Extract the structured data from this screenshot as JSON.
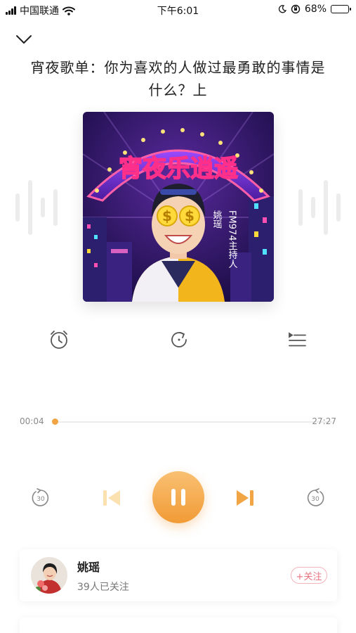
{
  "status_bar": {
    "carrier": "中国联通",
    "time": "下午6:01",
    "battery": "68%",
    "battery_level": 0.68
  },
  "header": {
    "collapse_icon": "chevron-down-icon"
  },
  "episode": {
    "title": "宵夜歌单：你为喜欢的人做过最勇敢的事情是什么？上"
  },
  "cover": {
    "sign_text": "宵夜乐逍遥",
    "host_caption": "姚瑶",
    "station_caption": "FM974主持人",
    "colors": {
      "sky": "#2a1a5e",
      "sign_yellow": "#ffd93a",
      "sign_pink": "#ff5fa8",
      "sign_cyan": "#52e0ff"
    }
  },
  "features": [
    {
      "name": "timer-button",
      "icon": "alarm-clock-icon"
    },
    {
      "name": "replay-button",
      "icon": "refresh-icon"
    },
    {
      "name": "playlist-button",
      "icon": "playlist-icon"
    }
  ],
  "player": {
    "current_time": "00:04",
    "total_time": "27:27",
    "progress": 0.0024,
    "accent": "#f0a443",
    "rewind_label": "30",
    "forward_label": "30"
  },
  "host": {
    "name": "姚瑶",
    "followers": "39人已关注",
    "follow_label": "+关注"
  }
}
